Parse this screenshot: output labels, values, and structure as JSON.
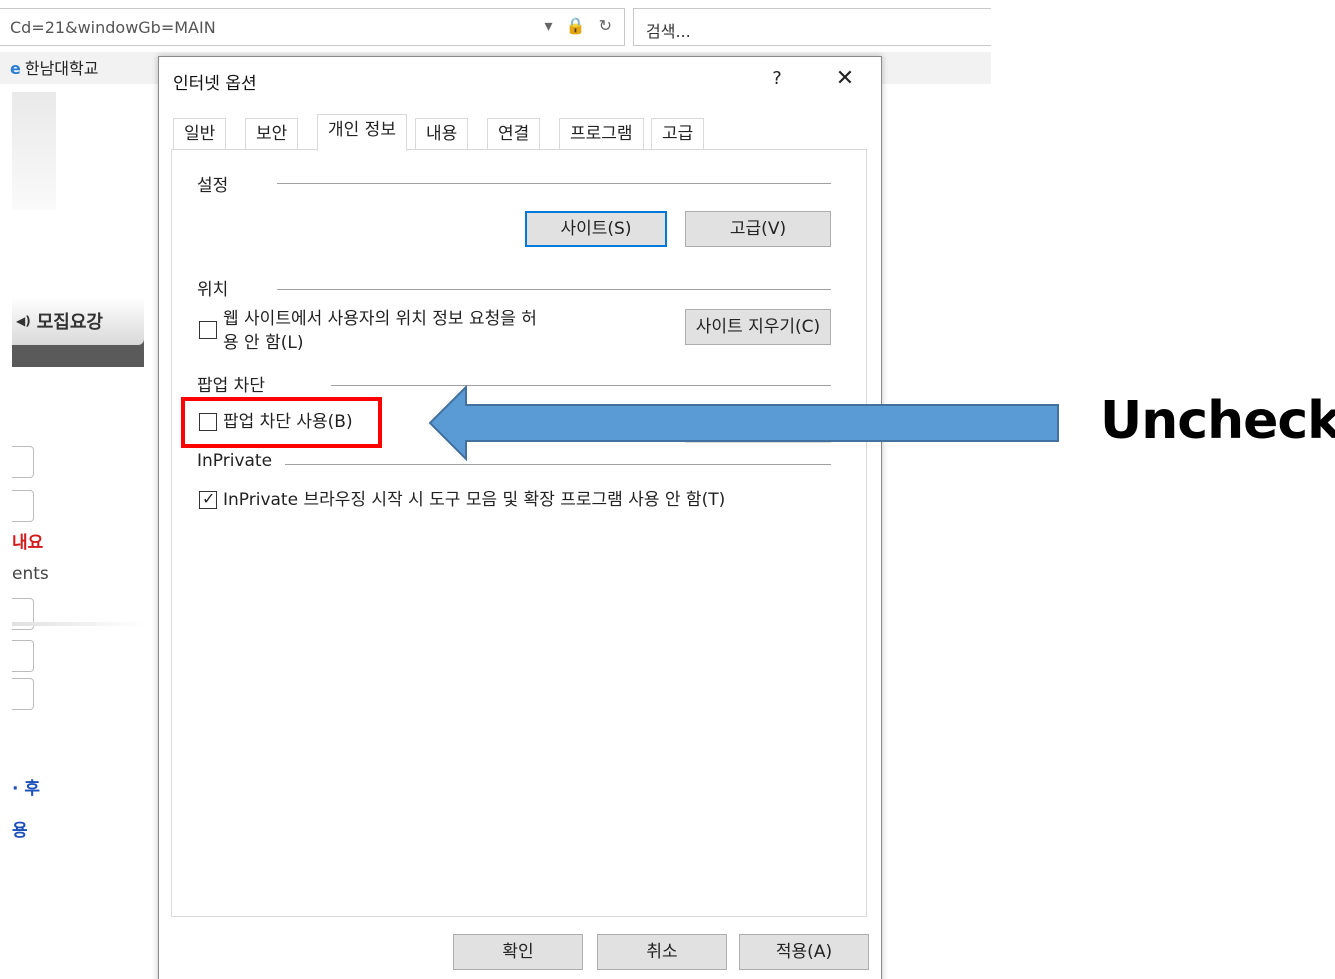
{
  "browser": {
    "address_text": "Cd=21&windowGb=MAIN",
    "address_icons": "▾ 🔒 ↻",
    "search_placeholder": "검색...",
    "fav_tab": "한남대학교"
  },
  "background": {
    "recruit_label": "모집요강",
    "side_red": "내요",
    "side_ents": "ents",
    "side_after": "· 후",
    "side_use": "용"
  },
  "dialog": {
    "title": "인터넷 옵션",
    "help_label": "?",
    "close_label": "✕",
    "tabs": [
      {
        "label": "일반"
      },
      {
        "label": "보안"
      },
      {
        "label": "개인 정보"
      },
      {
        "label": "내용"
      },
      {
        "label": "연결"
      },
      {
        "label": "프로그램"
      },
      {
        "label": "고급"
      }
    ],
    "active_tab": "개인 정보",
    "settings": {
      "label": "설정",
      "sites_button": "사이트(S)",
      "advanced_button": "고급(V)"
    },
    "location": {
      "label": "위치",
      "checkbox_line1": "웹 사이트에서 사용자의 위치 정보 요청을 허",
      "checkbox_line2": "용 안 함(L)",
      "checked": false,
      "clear_sites_button": "사이트 지우기(C)"
    },
    "popup": {
      "label": "팝업 차단",
      "checkbox_label": "팝업 차단 사용(B)",
      "checked": false
    },
    "inprivate": {
      "label": "InPrivate",
      "checkbox_label": "InPrivate 브라우징 시작 시 도구 모음 및 확장 프로그램 사용 안 함(T)",
      "checked": true
    },
    "footer": {
      "ok_button": "확인",
      "cancel_button": "취소",
      "apply_button": "적용(A)"
    }
  },
  "annotation": {
    "text": "Uncheck",
    "highlight_color": "#ff0000",
    "arrow_color": "#5b9bd5"
  }
}
